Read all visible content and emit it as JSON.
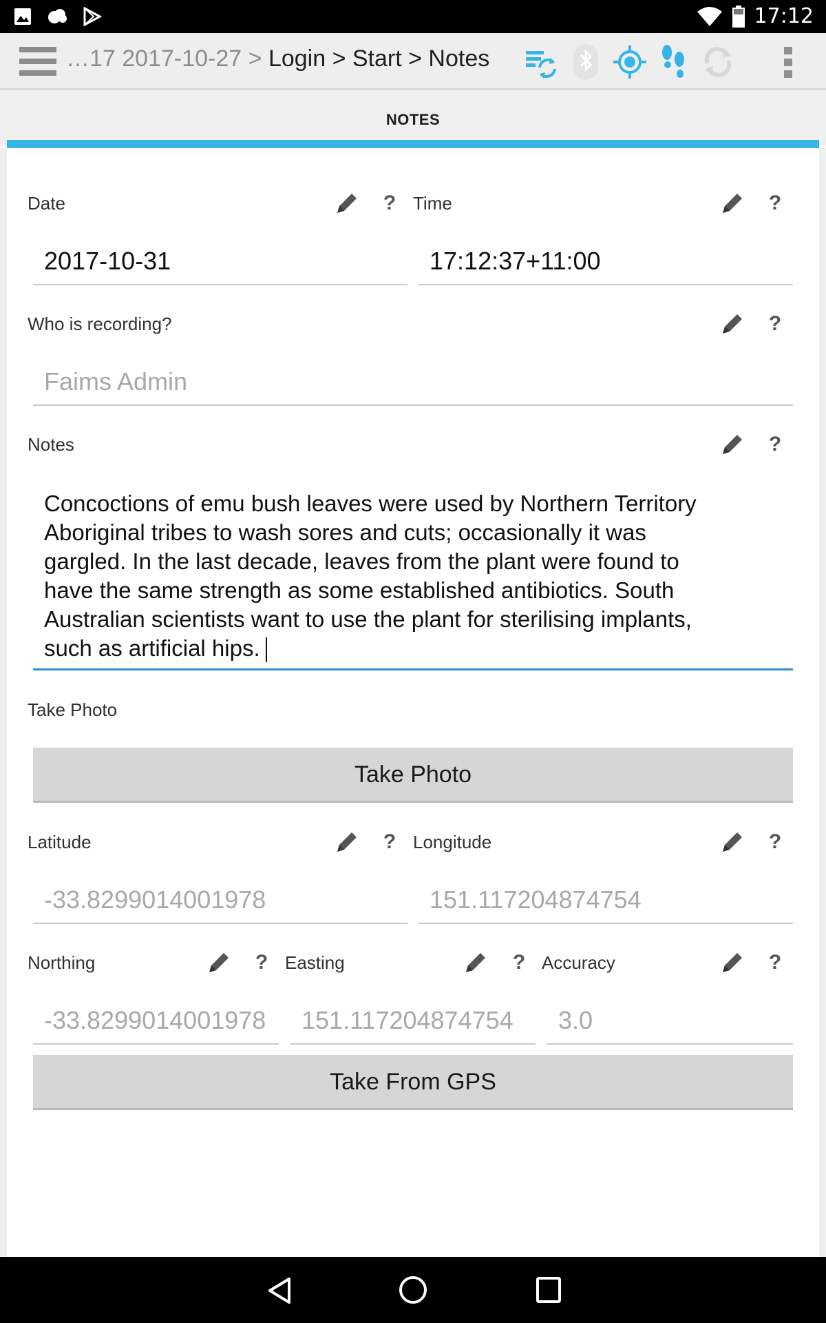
{
  "status_bar": {
    "time": "17:12",
    "left_icons": [
      "image-icon",
      "cloud-icon",
      "play-store-icon"
    ],
    "right_icons": [
      "wifi-icon",
      "battery-icon"
    ]
  },
  "action_bar": {
    "breadcrumb_dim": "…17 2017-10-27 > ",
    "breadcrumb_main": "Login > Start > Notes",
    "icons": [
      "sync-icon",
      "bluetooth-icon",
      "gps-target-icon",
      "footsteps-icon",
      "refresh-icon",
      "overflow-menu-icon"
    ],
    "accent_color": "#36b4e5"
  },
  "tab": {
    "label": "NOTES"
  },
  "form": {
    "date": {
      "label": "Date",
      "value": "2017-10-31"
    },
    "time": {
      "label": "Time",
      "value": "17:12:37+11:00"
    },
    "recorder": {
      "label": "Who is recording?",
      "placeholder": "Faims Admin"
    },
    "notes": {
      "label": "Notes",
      "lines": [
        "Concoctions of emu bush leaves were used by Northern Territory",
        "Aboriginal tribes to wash sores and cuts; occasionally it was",
        "gargled. In the last decade, leaves from the plant were found to",
        "have the same strength as some established antibiotics. South",
        "Australian scientists want to use the plant for sterilising implants,",
        "such as artificial hips."
      ]
    },
    "photo": {
      "label": "Take Photo",
      "button": "Take Photo"
    },
    "latitude": {
      "label": "Latitude",
      "value": "-33.8299014001978"
    },
    "longitude": {
      "label": "Longitude",
      "value": "151.117204874754"
    },
    "northing": {
      "label": "Northing",
      "value": "-33.8299014001978"
    },
    "easting": {
      "label": "Easting",
      "value": "151.117204874754"
    },
    "accuracy": {
      "label": "Accuracy",
      "value": "3.0"
    },
    "gps_button": "Take From GPS",
    "help_glyph": "?"
  }
}
